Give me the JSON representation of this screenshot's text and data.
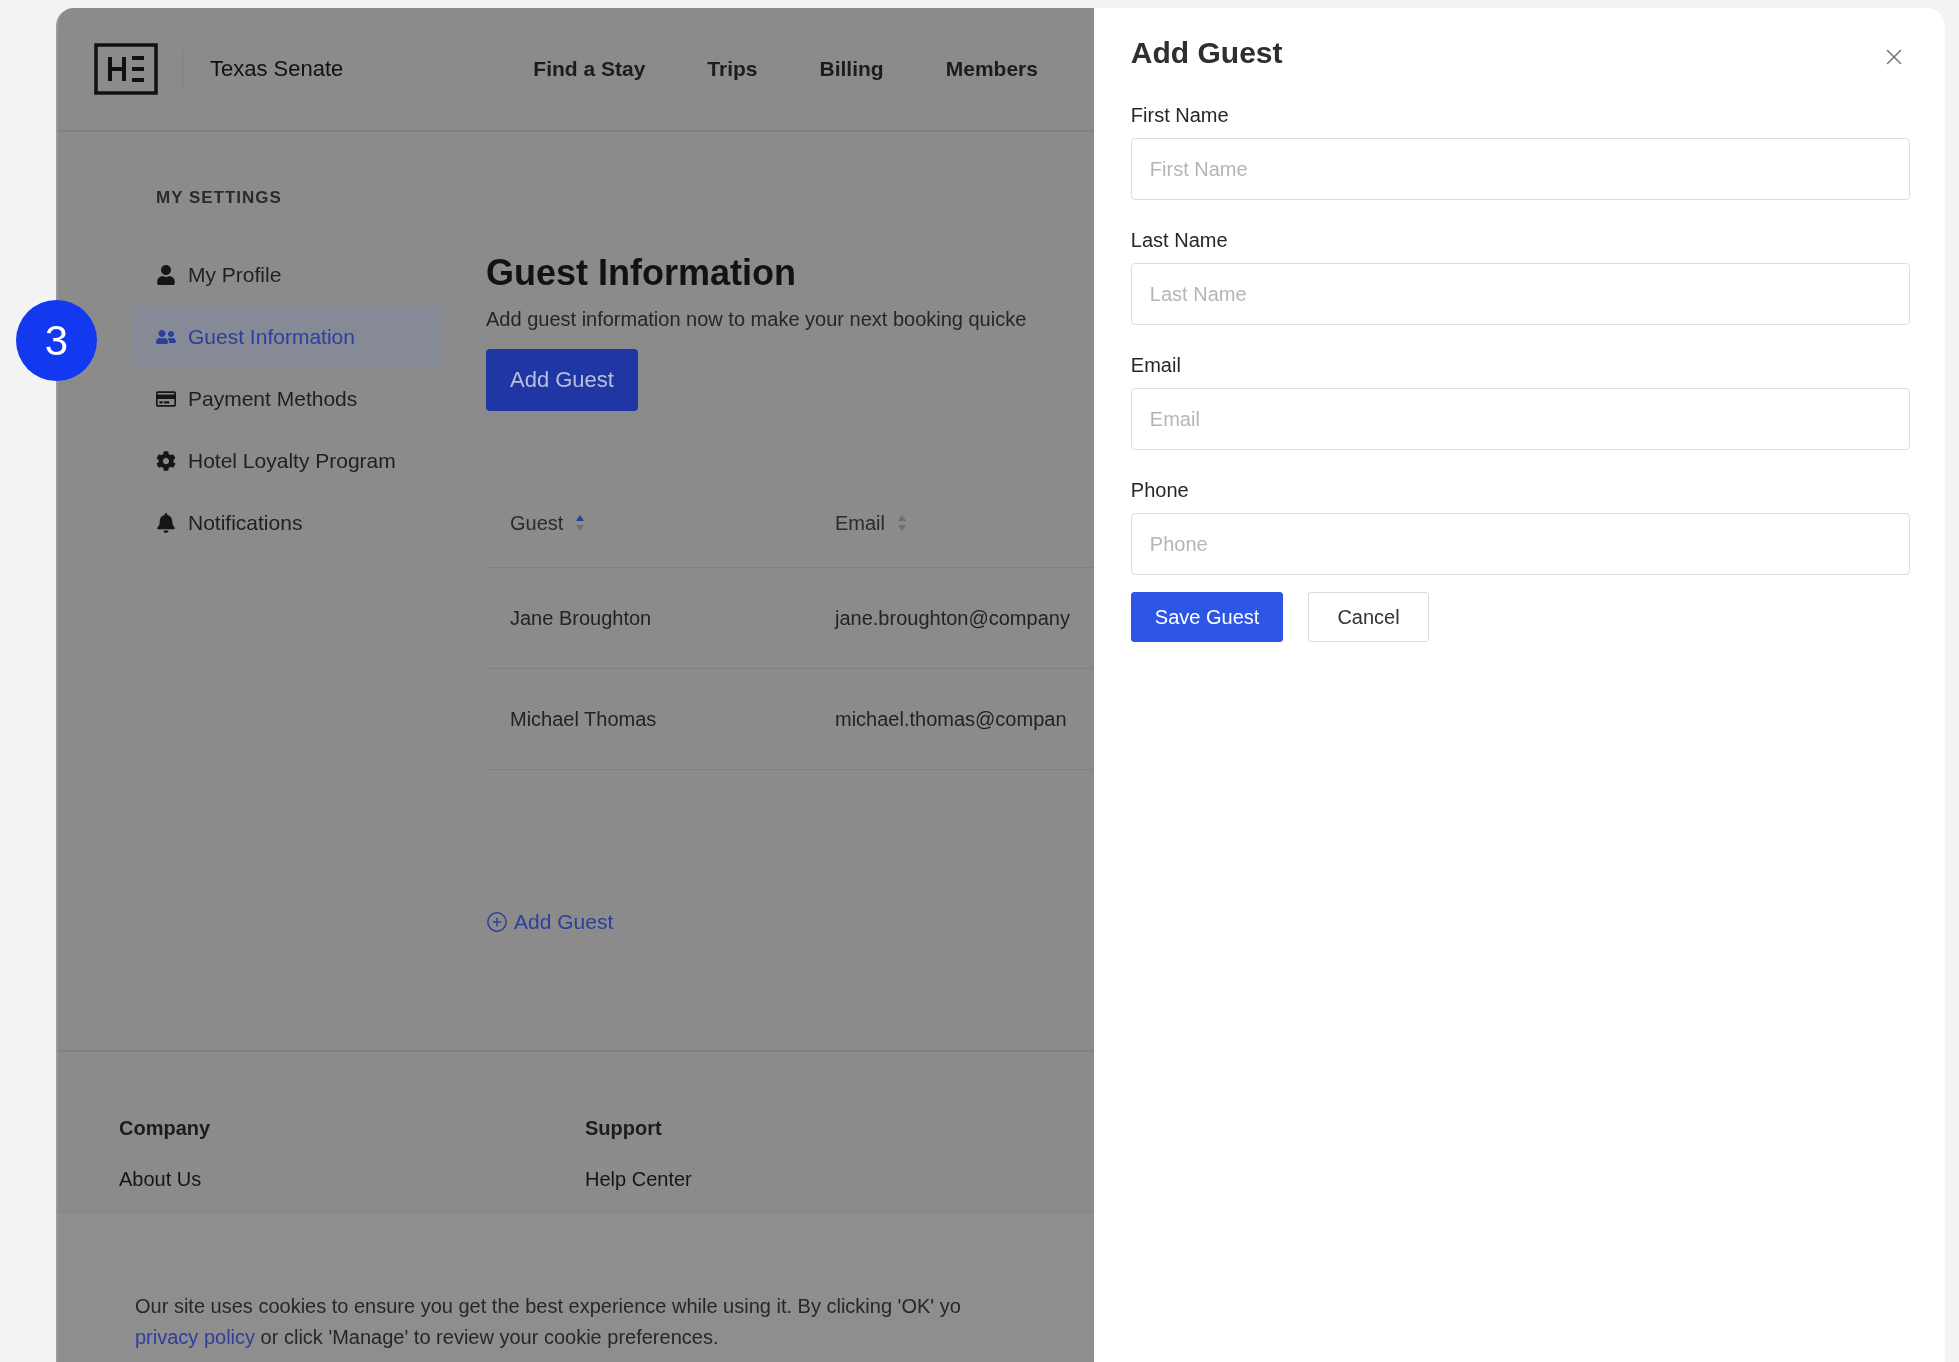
{
  "annotation": {
    "label": "3"
  },
  "header": {
    "brand": "Texas Senate",
    "nav": [
      "Find a Stay",
      "Trips",
      "Billing",
      "Members"
    ]
  },
  "sidebar": {
    "heading": "MY SETTINGS",
    "items": [
      {
        "label": "My Profile",
        "selected": false
      },
      {
        "label": "Guest Information",
        "selected": true
      },
      {
        "label": "Payment Methods",
        "selected": false
      },
      {
        "label": "Hotel Loyalty Program",
        "selected": false
      },
      {
        "label": "Notifications",
        "selected": false
      }
    ]
  },
  "main": {
    "title": "Guest Information",
    "subtitle": "Add guest information now to make your next booking quicke",
    "add_button": "Add Guest",
    "table": {
      "columns": [
        {
          "label": "Guest",
          "sorted": true
        },
        {
          "label": "Email",
          "sorted": false
        }
      ],
      "rows": [
        [
          "Jane Broughton",
          "jane.broughton@company"
        ],
        [
          "Michael Thomas",
          "michael.thomas@compan"
        ]
      ]
    },
    "add_link": "Add Guest"
  },
  "footer": {
    "columns": [
      {
        "heading": "Company",
        "links": [
          "About Us"
        ]
      },
      {
        "heading": "Support",
        "links": [
          "Help Center"
        ]
      }
    ]
  },
  "cookie_banner": {
    "line_1": "Our site uses cookies to ensure you get the best experience while using it. By clicking 'OK' yo",
    "link": "privacy policy",
    "line_2": "or click 'Manage' to review your cookie preferences."
  },
  "drawer": {
    "title": "Add Guest",
    "fields": [
      {
        "label": "First Name",
        "placeholder": "First Name"
      },
      {
        "label": "Last Name",
        "placeholder": "Last Name"
      },
      {
        "label": "Email",
        "placeholder": "Email"
      },
      {
        "label": "Phone",
        "placeholder": "Phone"
      }
    ],
    "buttons": [
      {
        "label": "Save Guest",
        "kind": "primary"
      },
      {
        "label": "Cancel",
        "kind": "secondary"
      }
    ]
  }
}
